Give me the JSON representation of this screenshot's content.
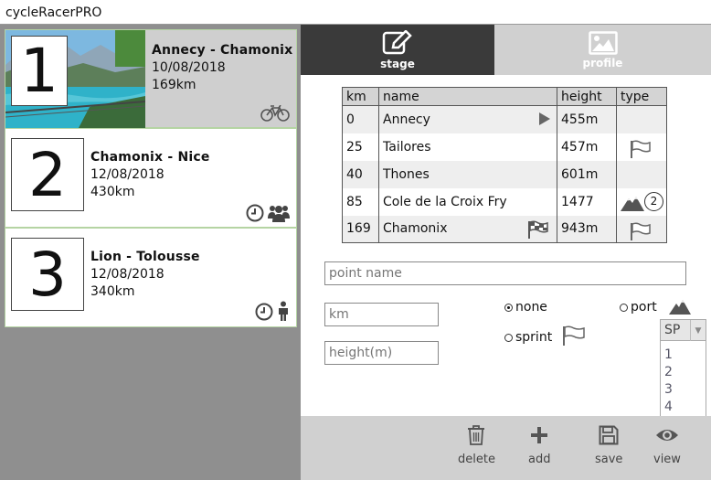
{
  "window": {
    "title": "cycleRacerPRO"
  },
  "stages": [
    {
      "number": "1",
      "title": "Annecy - Chamonix",
      "date": "10/08/2018",
      "distance": "169km",
      "icons": [
        "bicycle-icon"
      ]
    },
    {
      "number": "2",
      "title": "Chamonix - Nice",
      "date": "12/08/2018",
      "distance": "430km",
      "icons": [
        "clock-icon",
        "group-icon"
      ]
    },
    {
      "number": "3",
      "title": "Lion - Tolousse",
      "date": "12/08/2018",
      "distance": "340km",
      "icons": [
        "clock-icon",
        "person-icon"
      ]
    }
  ],
  "tabs": [
    {
      "label": "stage",
      "icon": "edit-icon",
      "active": true
    },
    {
      "label": "profile",
      "icon": "image-icon",
      "active": false
    }
  ],
  "table": {
    "headers": [
      "km",
      "name",
      "height",
      "type"
    ],
    "rows": [
      {
        "km": "0",
        "name": "Annecy",
        "height": "455m",
        "name_icon": "play-icon",
        "type_icon": ""
      },
      {
        "km": "25",
        "name": "Tailores",
        "height": "457m",
        "name_icon": "",
        "type_icon": "flag-icon"
      },
      {
        "km": "40",
        "name": "Thones",
        "height": "601m",
        "name_icon": "",
        "type_icon": ""
      },
      {
        "km": "85",
        "name": "Cole de la Croix Fry",
        "height": "1477",
        "name_icon": "",
        "type_icon": "mountain-icon",
        "type_badge": "2"
      },
      {
        "km": "169",
        "name": "Chamonix",
        "height": "943m",
        "name_icon": "checkered-flag-icon",
        "type_icon": "flag-icon"
      }
    ]
  },
  "form": {
    "point_name_placeholder": "point name",
    "km_placeholder": "km",
    "height_placeholder": "height(m)",
    "radio_none": "none",
    "radio_port": "port",
    "radio_sprint": "sprint",
    "selected_radio": "none"
  },
  "category_dropdown": {
    "selected": "SP",
    "options": [
      "1",
      "2",
      "3",
      "4"
    ]
  },
  "actions": [
    {
      "label": "delete",
      "icon": "trash-icon"
    },
    {
      "label": "add",
      "icon": "plus-icon"
    },
    {
      "label": "save",
      "icon": "floppy-icon"
    },
    {
      "label": "view",
      "icon": "eye-icon"
    }
  ]
}
